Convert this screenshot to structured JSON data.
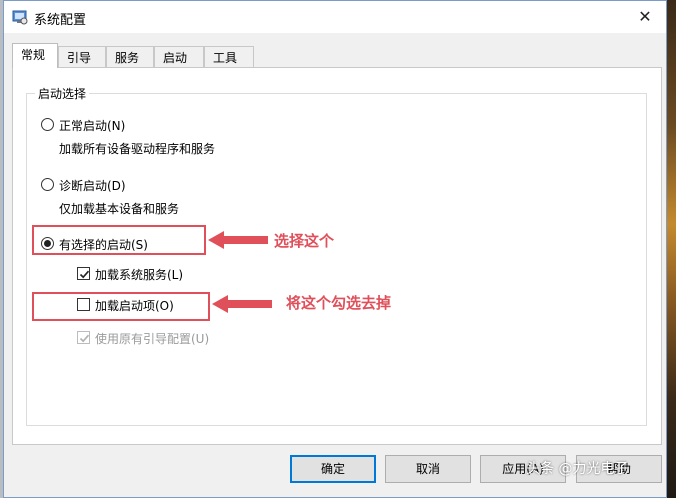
{
  "window": {
    "title": "系统配置",
    "close_glyph": "✕",
    "app_icon": "msconfig-icon"
  },
  "tabs": [
    {
      "label": "常规",
      "active": true
    },
    {
      "label": "引导",
      "active": false
    },
    {
      "label": "服务",
      "active": false
    },
    {
      "label": "启动",
      "active": false
    },
    {
      "label": "工具",
      "active": false
    }
  ],
  "startup_group": {
    "legend": "启动选择",
    "normal": {
      "label": "正常启动(N)",
      "desc": "加载所有设备驱动程序和服务",
      "selected": false
    },
    "diagnostic": {
      "label": "诊断启动(D)",
      "desc": "仅加载基本设备和服务",
      "selected": false
    },
    "selective": {
      "label": "有选择的启动(S)",
      "selected": true
    },
    "load_services": {
      "label": "加载系统服务(L)",
      "checked": true
    },
    "load_startup": {
      "label": "加载启动项(O)",
      "checked": false
    },
    "use_original_boot": {
      "label": "使用原有引导配置(U)",
      "checked": true,
      "disabled": true
    }
  },
  "annotations": {
    "select_this": "选择这个",
    "uncheck_this": "将这个勾选去掉",
    "color": "#e0505a"
  },
  "buttons": {
    "ok": "确定",
    "cancel": "取消",
    "apply": "应用(A)",
    "help": "帮助"
  },
  "watermark": "头条 @力光电子"
}
